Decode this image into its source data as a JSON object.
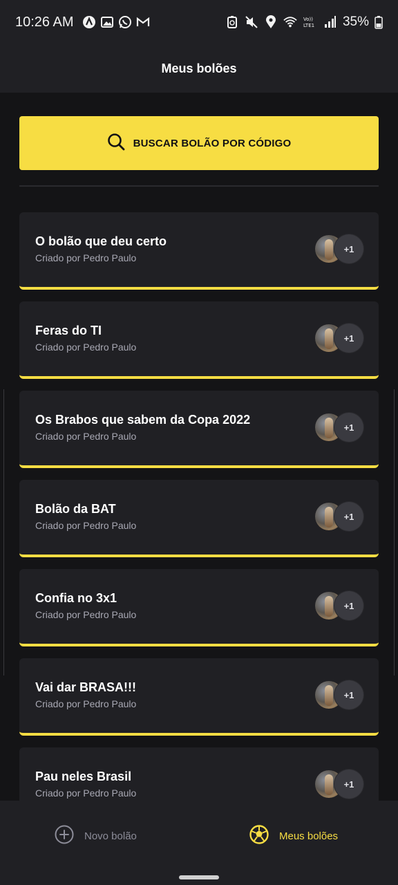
{
  "status_bar": {
    "time": "10:26 AM",
    "battery": "35%",
    "network": "LTE1"
  },
  "header": {
    "title": "Meus bolões"
  },
  "search_button": {
    "label": "BUSCAR BOLÃO POR CÓDIGO"
  },
  "pools": [
    {
      "title": "O bolão que deu certo",
      "creator": "Criado por Pedro Paulo",
      "extra_members": "+1"
    },
    {
      "title": "Feras do TI",
      "creator": "Criado por Pedro Paulo",
      "extra_members": "+1"
    },
    {
      "title": "Os Brabos que sabem da Copa 2022",
      "creator": "Criado por Pedro Paulo",
      "extra_members": "+1"
    },
    {
      "title": "Bolão da BAT",
      "creator": "Criado por Pedro Paulo",
      "extra_members": "+1"
    },
    {
      "title": "Confia no 3x1",
      "creator": "Criado por Pedro Paulo",
      "extra_members": "+1"
    },
    {
      "title": "Vai dar BRASA!!!",
      "creator": "Criado por Pedro Paulo",
      "extra_members": "+1"
    },
    {
      "title": "Pau neles Brasil",
      "creator": "Criado por Pedro Paulo",
      "extra_members": "+1"
    }
  ],
  "bottom_nav": {
    "new_pool": {
      "label": "Novo bolão",
      "icon": "plus-circle-icon"
    },
    "my_pools": {
      "label": "Meus bolões",
      "icon": "soccer-ball-icon"
    }
  },
  "colors": {
    "accent": "#f7dd43",
    "background": "#141416",
    "surface": "#202024",
    "muted_text": "#a8a8b3"
  }
}
